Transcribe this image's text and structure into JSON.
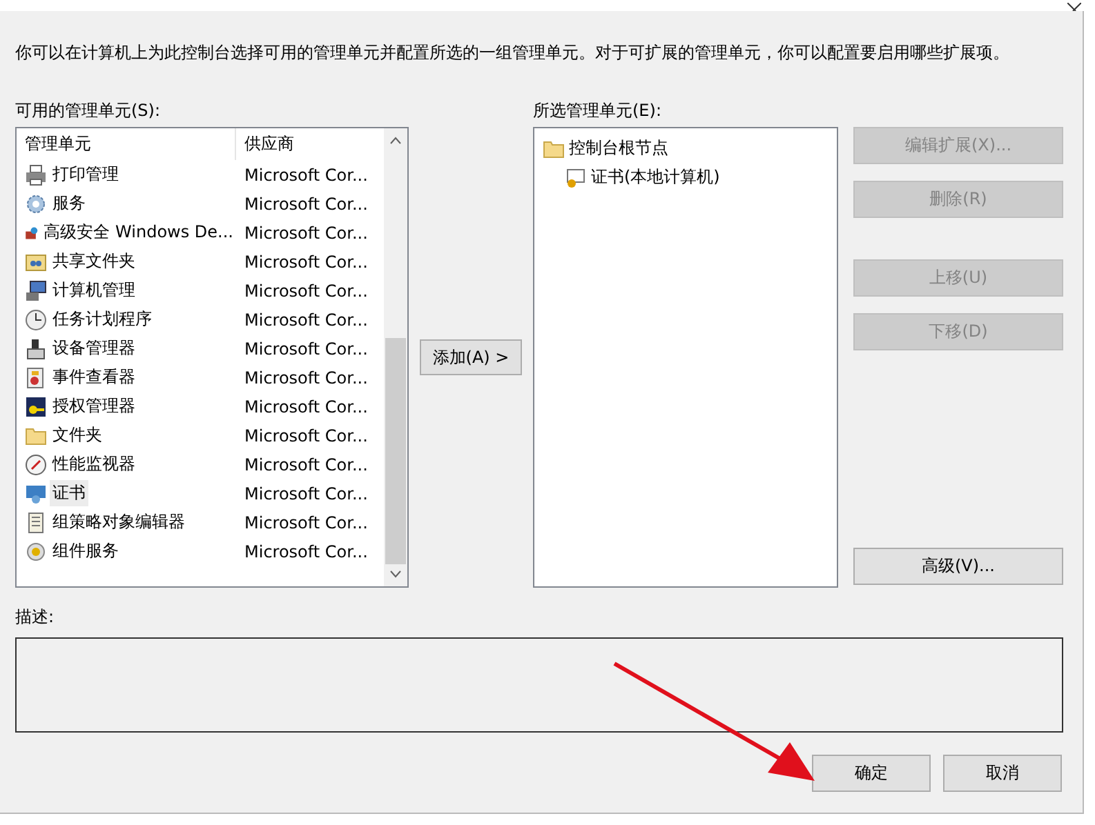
{
  "intro": "你可以在计算机上为此控制台选择可用的管理单元并配置所选的一组管理单元。对于可扩展的管理单元，你可以配置要启用哪些扩展项。",
  "available": {
    "label": "可用的管理单元(S):",
    "columns": [
      "管理单元",
      "供应商"
    ],
    "rows": [
      {
        "name": "打印管理",
        "vendor": "Microsoft Cor...",
        "selected": false
      },
      {
        "name": "服务",
        "vendor": "Microsoft Cor...",
        "selected": false
      },
      {
        "name": "高级安全 Windows De...",
        "vendor": "Microsoft Cor...",
        "selected": false
      },
      {
        "name": "共享文件夹",
        "vendor": "Microsoft Cor...",
        "selected": false
      },
      {
        "name": "计算机管理",
        "vendor": "Microsoft Cor...",
        "selected": false
      },
      {
        "name": "任务计划程序",
        "vendor": "Microsoft Cor...",
        "selected": false
      },
      {
        "name": "设备管理器",
        "vendor": "Microsoft Cor...",
        "selected": false
      },
      {
        "name": "事件查看器",
        "vendor": "Microsoft Cor...",
        "selected": false
      },
      {
        "name": "授权管理器",
        "vendor": "Microsoft Cor...",
        "selected": false
      },
      {
        "name": "文件夹",
        "vendor": "Microsoft Cor...",
        "selected": false
      },
      {
        "name": "性能监视器",
        "vendor": "Microsoft Cor...",
        "selected": false
      },
      {
        "name": "证书",
        "vendor": "Microsoft Cor...",
        "selected": true
      },
      {
        "name": "组策略对象编辑器",
        "vendor": "Microsoft Cor...",
        "selected": false
      },
      {
        "name": "组件服务",
        "vendor": "Microsoft Cor...",
        "selected": false
      }
    ]
  },
  "add_button": "添加(A) >",
  "selected_snapins": {
    "label": "所选管理单元(E):",
    "tree": [
      {
        "label": "控制台根节点",
        "children": [
          {
            "label": "证书(本地计算机)"
          }
        ]
      }
    ]
  },
  "side_buttons": [
    {
      "label": "编辑扩展(X)...",
      "disabled": true
    },
    {
      "label": "删除(R)",
      "disabled": true
    },
    {
      "label": "上移(U)",
      "disabled": true
    },
    {
      "label": "下移(D)",
      "disabled": true
    },
    {
      "label": "高级(V)...",
      "disabled": false
    }
  ],
  "description": {
    "label": "描述:"
  },
  "footer_buttons": [
    {
      "label": "确定",
      "disabled": false
    },
    {
      "label": "取消",
      "disabled": false
    }
  ]
}
